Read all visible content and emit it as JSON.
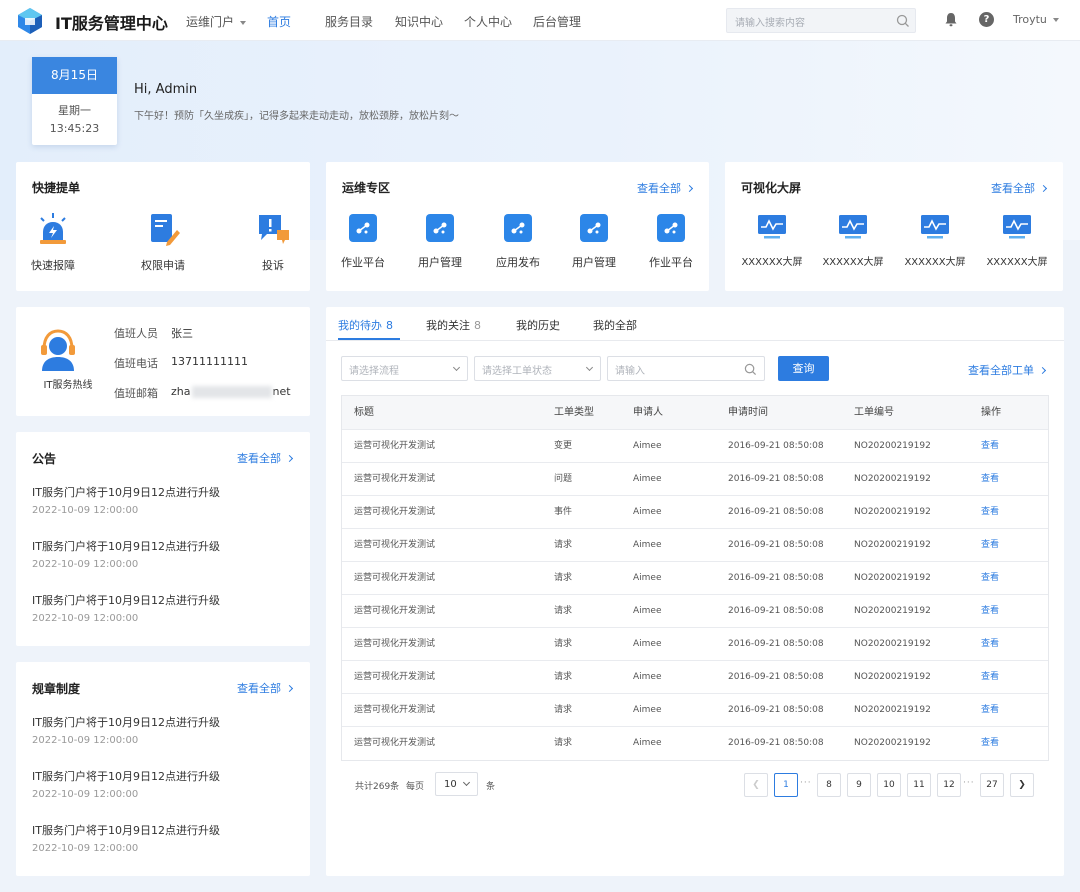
{
  "app": {
    "title": "IT服务管理中心"
  },
  "nav": {
    "items": [
      {
        "label": "运维门户",
        "dropdown": true
      },
      {
        "label": "首页",
        "active": true
      },
      {
        "label": "服务目录"
      },
      {
        "label": "知识中心"
      },
      {
        "label": "个人中心"
      },
      {
        "label": "后台管理"
      }
    ],
    "search_placeholder": "请输入搜索内容",
    "user": "Troytu"
  },
  "hero": {
    "date": "8月15日",
    "weekday": "星期一",
    "time": "13:45:23",
    "greeting": "Hi, Admin",
    "message": "下午好！预防「久坐成疾」，记得多起来走动走动，放松颈脖，放松片刻～"
  },
  "quick": {
    "title": "快捷提单",
    "items": [
      {
        "label": "快速报障",
        "icon": "alarm-icon"
      },
      {
        "label": "权限申请",
        "icon": "document-edit-icon"
      },
      {
        "label": "投诉",
        "icon": "complaint-icon"
      }
    ]
  },
  "ops": {
    "title": "运维专区",
    "view_all": "查看全部",
    "items": [
      {
        "label": "作业平台"
      },
      {
        "label": "用户管理"
      },
      {
        "label": "应用发布"
      },
      {
        "label": "用户管理"
      },
      {
        "label": "作业平台"
      }
    ]
  },
  "screens": {
    "title": "可视化大屏",
    "view_all": "查看全部",
    "items": [
      {
        "label": "XXXXXX大屏"
      },
      {
        "label": "XXXXXX大屏"
      },
      {
        "label": "XXXXXX大屏"
      },
      {
        "label": "XXXXXX大屏"
      }
    ]
  },
  "hotline": {
    "label": "IT服务热线",
    "rows": [
      {
        "key": "值班人员",
        "value": "张三"
      },
      {
        "key": "值班电话",
        "value": "13711111111"
      },
      {
        "key": "值班邮箱",
        "value_start": "zha",
        "value_end": "net"
      }
    ]
  },
  "notices": {
    "title": "公告",
    "view_all": "查看全部",
    "items": [
      {
        "title": "IT服务门户将于10月9日12点进行升级",
        "date": "2022-10-09  12:00:00"
      },
      {
        "title": "IT服务门户将于10月9日12点进行升级",
        "date": "2022-10-09  12:00:00"
      },
      {
        "title": "IT服务门户将于10月9日12点进行升级",
        "date": "2022-10-09  12:00:00"
      }
    ]
  },
  "rules": {
    "title": "规章制度",
    "view_all": "查看全部",
    "items": [
      {
        "title": "IT服务门户将于10月9日12点进行升级",
        "date": "2022-10-09  12:00:00"
      },
      {
        "title": "IT服务门户将于10月9日12点进行升级",
        "date": "2022-10-09  12:00:00"
      },
      {
        "title": "IT服务门户将于10月9日12点进行升级",
        "date": "2022-10-09  12:00:00"
      }
    ]
  },
  "tickets": {
    "tabs": [
      {
        "label": "我的待办",
        "count": "8",
        "active": true
      },
      {
        "label": "我的关注",
        "count": "8"
      },
      {
        "label": "我的历史"
      },
      {
        "label": "我的全部"
      }
    ],
    "filters": {
      "process_placeholder": "请选择流程",
      "status_placeholder": "请选择工单状态",
      "keyword_placeholder": "请输入",
      "query_label": "查询",
      "view_all": "查看全部工单"
    },
    "columns": [
      "标题",
      "工单类型",
      "申请人",
      "申请时间",
      "工单编号",
      "操作"
    ],
    "rows": [
      {
        "title": "运营可视化开发测试",
        "type": "变更",
        "applicant": "Aimee",
        "time": "2016-09-21  08:50:08",
        "number": "NO20200219192",
        "action": "查看"
      },
      {
        "title": "运营可视化开发测试",
        "type": "问题",
        "applicant": "Aimee",
        "time": "2016-09-21  08:50:08",
        "number": "NO20200219192",
        "action": "查看"
      },
      {
        "title": "运营可视化开发测试",
        "type": "事件",
        "applicant": "Aimee",
        "time": "2016-09-21  08:50:08",
        "number": "NO20200219192",
        "action": "查看"
      },
      {
        "title": "运营可视化开发测试",
        "type": "请求",
        "applicant": "Aimee",
        "time": "2016-09-21  08:50:08",
        "number": "NO20200219192",
        "action": "查看"
      },
      {
        "title": "运营可视化开发测试",
        "type": "请求",
        "applicant": "Aimee",
        "time": "2016-09-21  08:50:08",
        "number": "NO20200219192",
        "action": "查看"
      },
      {
        "title": "运营可视化开发测试",
        "type": "请求",
        "applicant": "Aimee",
        "time": "2016-09-21  08:50:08",
        "number": "NO20200219192",
        "action": "查看"
      },
      {
        "title": "运营可视化开发测试",
        "type": "请求",
        "applicant": "Aimee",
        "time": "2016-09-21  08:50:08",
        "number": "NO20200219192",
        "action": "查看"
      },
      {
        "title": "运营可视化开发测试",
        "type": "请求",
        "applicant": "Aimee",
        "time": "2016-09-21  08:50:08",
        "number": "NO20200219192",
        "action": "查看"
      },
      {
        "title": "运营可视化开发测试",
        "type": "请求",
        "applicant": "Aimee",
        "time": "2016-09-21  08:50:08",
        "number": "NO20200219192",
        "action": "查看"
      },
      {
        "title": "运营可视化开发测试",
        "type": "请求",
        "applicant": "Aimee",
        "time": "2016-09-21  08:50:08",
        "number": "NO20200219192",
        "action": "查看"
      }
    ],
    "pagination": {
      "total_text": "共计269条",
      "per_page_label": "每页",
      "per_page": "10",
      "unit": "条",
      "pages": [
        "1",
        "8",
        "9",
        "10",
        "11",
        "12",
        "27"
      ],
      "current": "1"
    }
  }
}
